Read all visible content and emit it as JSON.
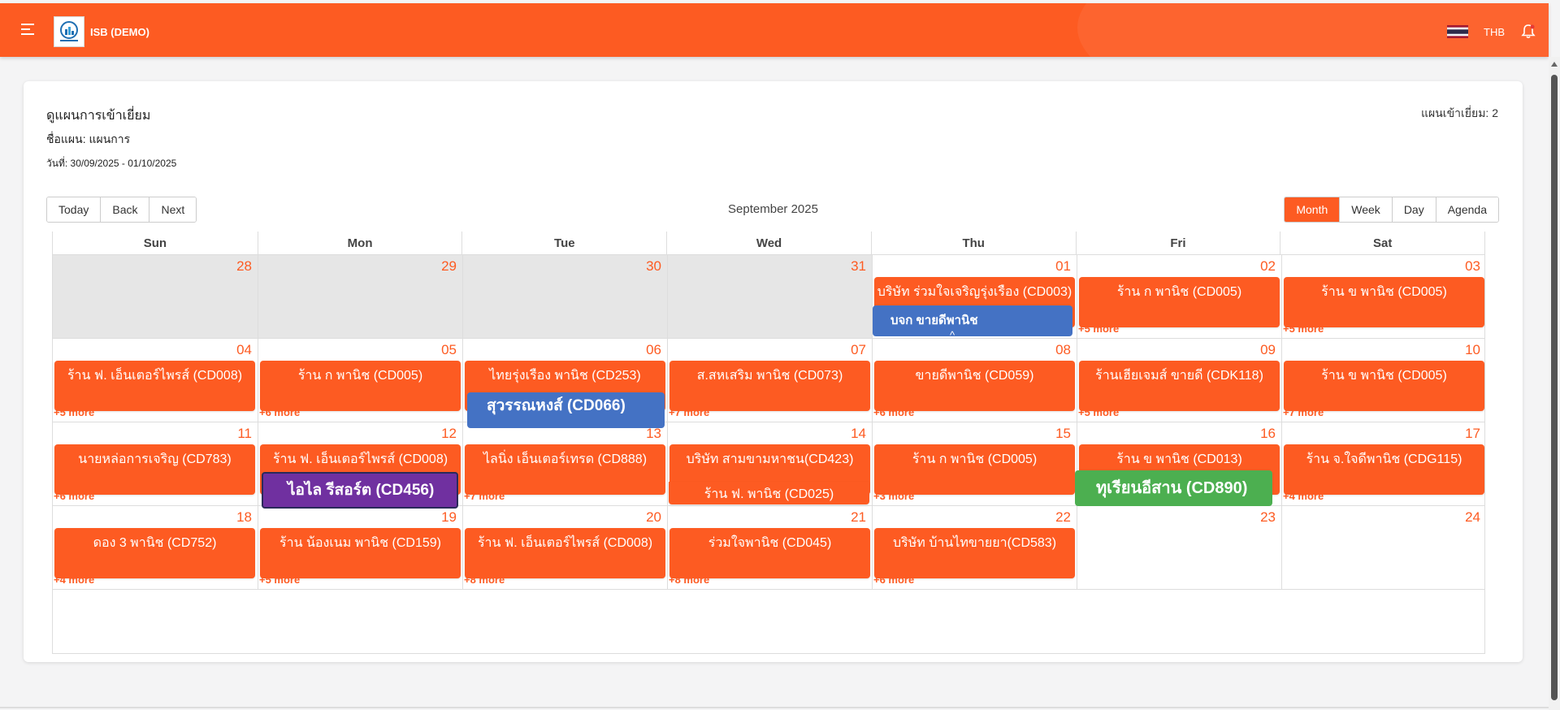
{
  "app": {
    "title": "ISB (DEMO)",
    "currency": "THB"
  },
  "icons": {
    "menu": "menu-icon",
    "logo": "company-logo",
    "flag": "thai-flag-icon",
    "bell": "bell-icon"
  },
  "colors": {
    "accent": "#fd5b22",
    "blue_tag": "#4472c4",
    "purple_tag": "#7030a0",
    "green_tag": "#4caf50"
  },
  "header": {
    "title": "ดูแผนการเข้าเยี่ยม",
    "plan_name": "ชื่อแผน: แผนการ",
    "plan_date": "วันที่: 30/09/2025 - 01/10/2025",
    "plan_count": "แผนเข้าเยี่ยม: 2"
  },
  "toolbar": {
    "nav": [
      "Today",
      "Back",
      "Next"
    ],
    "label": "September 2025",
    "views": [
      "Month",
      "Week",
      "Day",
      "Agenda"
    ],
    "active_view": "Month"
  },
  "calendar": {
    "days_of_week": [
      "Sun",
      "Mon",
      "Tue",
      "Wed",
      "Thu",
      "Fri",
      "Sat"
    ],
    "weeks": [
      {
        "days": [
          {
            "num": "28",
            "off": true
          },
          {
            "num": "29",
            "off": true
          },
          {
            "num": "30",
            "off": true
          },
          {
            "num": "31",
            "off": true
          },
          {
            "num": "01",
            "event": "บริษัท ร่วมใจเจริญรุ่งเรือง (CD003)"
          },
          {
            "num": "02",
            "event": "ร้าน ก พานิช (CD005)",
            "more": "+5 more"
          },
          {
            "num": "03",
            "event": "ร้าน ข พานิช (CD005)",
            "more": "+5 more"
          }
        ]
      },
      {
        "days": [
          {
            "num": "04",
            "event": "ร้าน ฟ. เอ็นเตอร์ไพรส์ (CD008)",
            "more": "+5 more"
          },
          {
            "num": "05",
            "event": "ร้าน ก พานิช (CD005)",
            "more": "+6 more"
          },
          {
            "num": "06",
            "event": "ไทยรุ่งเรือง พานิช (CD253)"
          },
          {
            "num": "07",
            "event": "ส.สหเสริม พานิช (CD073)",
            "more": "+7 more"
          },
          {
            "num": "08",
            "event": "ขายดีพานิช (CD059)",
            "more": "+6 more"
          },
          {
            "num": "09",
            "event": "ร้านเฮียเจมส์ ขายดี (CDK118)",
            "more": "+5 more"
          },
          {
            "num": "10",
            "event": "ร้าน ข พานิช (CD005)",
            "more": "+7 more"
          }
        ]
      },
      {
        "days": [
          {
            "num": "11",
            "event": "นายหล่อการเจริญ (CD783)",
            "more": "+6 more"
          },
          {
            "num": "12",
            "event": "ร้าน ฟ. เอ็นเตอร์ไพรส์ (CD008)"
          },
          {
            "num": "13",
            "event": "ไลนิ่ง เอ็นเตอร์เทรด (CD888)",
            "more": "+7 more"
          },
          {
            "num": "14",
            "event": "บริษัท สามขามหาชน(CD423)"
          },
          {
            "num": "15",
            "event": "ร้าน ก พานิช (CD005)",
            "more": "+3 more"
          },
          {
            "num": "16",
            "event": "ร้าน ข พานิช (CD013)"
          },
          {
            "num": "17",
            "event": "ร้าน จ.ใจดีพานิช (CDG115)",
            "more": "+4 more"
          }
        ]
      },
      {
        "days": [
          {
            "num": "18",
            "event": "ดอง 3 พานิช (CD752)",
            "more": "+4 more"
          },
          {
            "num": "19",
            "event": "ร้าน น้องเนม พานิช (CD159)",
            "more": "+5 more"
          },
          {
            "num": "20",
            "event": "ร้าน ฟ. เอ็นเตอร์ไพรส์ (CD008)",
            "more": "+8 more"
          },
          {
            "num": "21",
            "event": "ร่วมใจพานิช (CD045)",
            "more": "+8 more"
          },
          {
            "num": "22",
            "event": "บริษัท บ้านไทขายยา(CD583)",
            "more": "+6 more"
          },
          {
            "num": "23"
          },
          {
            "num": "24"
          }
        ]
      }
    ],
    "extra_event_wed14": "ร้าน ฟ. พานิช (CD025)",
    "overlay_tags": {
      "thu01": "บจก ขายดีพานิช",
      "tue06": "สุวรรณหงส์ (CD066)",
      "mon12": "ไอไล รีสอร์ต (CD456)",
      "fri16": "ทุเรียนอีสาน (CD890)"
    }
  }
}
